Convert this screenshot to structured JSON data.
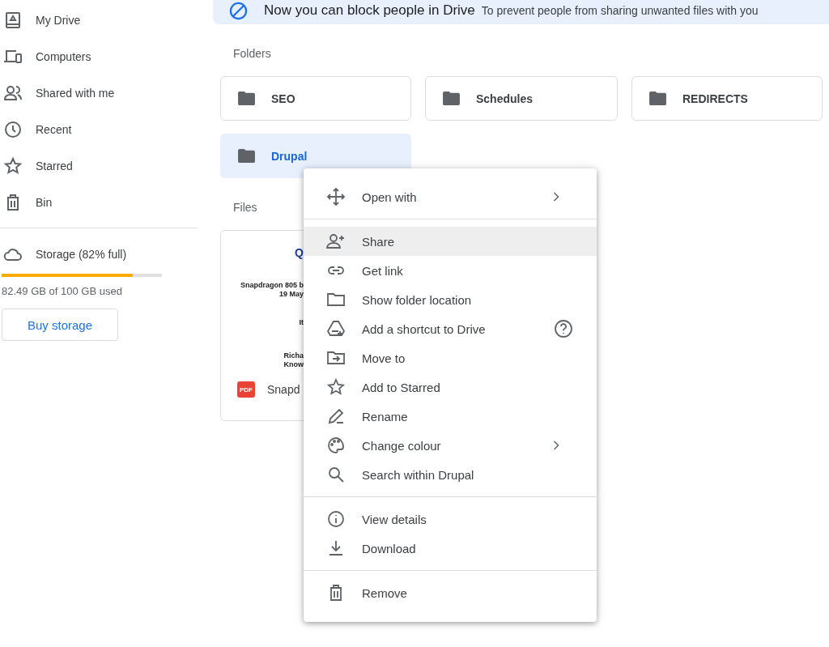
{
  "sidebar": {
    "items": [
      {
        "label": "My Drive"
      },
      {
        "label": "Computers"
      },
      {
        "label": "Shared with me"
      },
      {
        "label": "Recent"
      },
      {
        "label": "Starred"
      },
      {
        "label": "Bin"
      }
    ],
    "storage": {
      "label": "Storage (82% full)",
      "level": 0.82,
      "usage": "82.49 GB of 100 GB used",
      "button": "Buy storage"
    }
  },
  "banner": {
    "title": "Now you can block people in Drive",
    "text": "To prevent people from sharing unwanted files with you"
  },
  "folders": {
    "heading": "Folders",
    "items": [
      {
        "name": "SEO",
        "selected": false
      },
      {
        "name": "Schedules",
        "selected": false
      },
      {
        "name": "REDIRECTS",
        "selected": false
      },
      {
        "name": "Drupal",
        "selected": true
      }
    ]
  },
  "files": {
    "heading": "Files",
    "items": [
      {
        "name": "Snapd",
        "badge": "PDF",
        "preview": [
          "Q",
          "Snapdragon 805 b",
          "19 May",
          "It",
          "Richa",
          "Know"
        ]
      }
    ]
  },
  "context_menu": {
    "sections": [
      [
        {
          "label": "Open with",
          "highlighted": false,
          "submenu": true,
          "help": false
        }
      ],
      [
        {
          "label": "Share",
          "highlighted": true,
          "submenu": false,
          "help": false
        },
        {
          "label": "Get link",
          "highlighted": false,
          "submenu": false,
          "help": false
        },
        {
          "label": "Show folder location",
          "highlighted": false,
          "submenu": false,
          "help": false
        },
        {
          "label": "Add a shortcut to Drive",
          "highlighted": false,
          "submenu": false,
          "help": true
        },
        {
          "label": "Move to",
          "highlighted": false,
          "submenu": false,
          "help": false
        },
        {
          "label": "Add to Starred",
          "highlighted": false,
          "submenu": false,
          "help": false
        },
        {
          "label": "Rename",
          "highlighted": false,
          "submenu": false,
          "help": false
        },
        {
          "label": "Change colour",
          "highlighted": false,
          "submenu": true,
          "help": false
        },
        {
          "label": "Search within Drupal",
          "highlighted": false,
          "submenu": false,
          "help": false
        }
      ],
      [
        {
          "label": "View details",
          "highlighted": false,
          "submenu": false,
          "help": false
        },
        {
          "label": "Download",
          "highlighted": false,
          "submenu": false,
          "help": false
        }
      ],
      [
        {
          "label": "Remove",
          "highlighted": false,
          "submenu": false,
          "help": false
        }
      ]
    ]
  }
}
